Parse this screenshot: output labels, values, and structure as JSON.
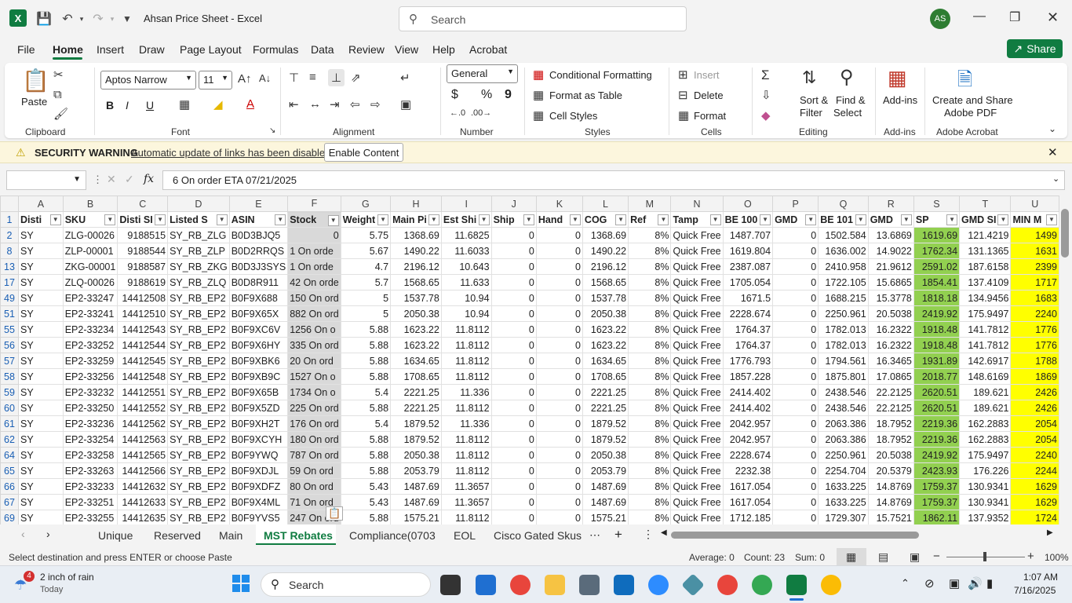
{
  "window": {
    "app_title": "Ahsan Price Sheet  -  Excel",
    "search_placeholder": "Search",
    "avatar_initials": "AS"
  },
  "menu": [
    "File",
    "Home",
    "Insert",
    "Draw",
    "Page Layout",
    "Formulas",
    "Data",
    "Review",
    "View",
    "Help",
    "Acrobat"
  ],
  "share_label": "Share",
  "ribbon": {
    "clipboard": {
      "paste": "Paste",
      "label": "Clipboard"
    },
    "font": {
      "name": "Aptos Narrow",
      "size": "11",
      "label": "Font",
      "bold": "B",
      "italic": "I",
      "underline": "U"
    },
    "alignment": {
      "label": "Alignment"
    },
    "number": {
      "format": "General",
      "label": "Number",
      "currency": "$",
      "percent": "%",
      "comma": "9"
    },
    "styles": {
      "conditional": "Conditional Formatting",
      "table": "Format as Table",
      "cell_styles": "Cell Styles",
      "label": "Styles"
    },
    "cells": {
      "insert": "Insert",
      "delete": "Delete",
      "format": "Format",
      "label": "Cells"
    },
    "editing": {
      "sort": "Sort &",
      "filter": "Filter",
      "find": "Find &",
      "select": "Select",
      "label": "Editing"
    },
    "addins": {
      "btn": "Add-ins",
      "label": "Add-ins"
    },
    "acrobat": {
      "btn1": "Create and Share",
      "btn2": "Adobe PDF",
      "label": "Adobe Acrobat"
    }
  },
  "security": {
    "title": "SECURITY WARNING",
    "message": "Automatic update of links has been disabled",
    "button": "Enable Content"
  },
  "formula": {
    "fx": "fx",
    "value": "6 On order ETA 07/21/2025"
  },
  "columns": [
    "A",
    "B",
    "C",
    "D",
    "E",
    "F",
    "G",
    "H",
    "I",
    "J",
    "K",
    "L",
    "M",
    "N",
    "O",
    "P",
    "Q",
    "R",
    "S",
    "T",
    "U"
  ],
  "headers": [
    "Disti",
    "SKU",
    "Disti SI",
    "Listed S",
    "ASIN",
    "Stock",
    "Weight",
    "Main Pi",
    "Est Shi",
    "Ship",
    "Hand",
    "COG",
    "Ref",
    "Tamp",
    "BE 100",
    "GMD",
    "BE 101",
    "GMD",
    "SP",
    "GMD SI",
    "MIN M"
  ],
  "rows": [
    {
      "n": "2",
      "c": [
        "SY",
        "ZLG-00026",
        "9188515",
        "SY_RB_ZLG",
        "B0D3BJQ5",
        "0",
        "5.75",
        "1368.69",
        "11.6825",
        "0",
        "0",
        "1368.69",
        "8%",
        "Quick Free",
        "1487.707",
        "0",
        "1502.584",
        "13.6869",
        "1619.69",
        "121.4219",
        "1499"
      ]
    },
    {
      "n": "8",
      "c": [
        "SY",
        "ZLP-00001",
        "9188544",
        "SY_RB_ZLP",
        "B0D2RRQS",
        "1 On orde",
        "5.67",
        "1490.22",
        "11.6033",
        "0",
        "0",
        "1490.22",
        "8%",
        "Quick Free",
        "1619.804",
        "0",
        "1636.002",
        "14.9022",
        "1762.34",
        "131.1365",
        "1631"
      ]
    },
    {
      "n": "13",
      "c": [
        "SY",
        "ZKG-00001",
        "9188587",
        "SY_RB_ZKG",
        "B0D3J3SYS",
        "1 On orde",
        "4.7",
        "2196.12",
        "10.643",
        "0",
        "0",
        "2196.12",
        "8%",
        "Quick Free",
        "2387.087",
        "0",
        "2410.958",
        "21.9612",
        "2591.02",
        "187.6158",
        "2399"
      ]
    },
    {
      "n": "17",
      "c": [
        "SY",
        "ZLQ-00026",
        "9188619",
        "SY_RB_ZLQ",
        "B0D8R911",
        "42 On orde",
        "5.7",
        "1568.65",
        "11.633",
        "0",
        "0",
        "1568.65",
        "8%",
        "Quick Free",
        "1705.054",
        "0",
        "1722.105",
        "15.6865",
        "1854.41",
        "137.4109",
        "1717"
      ]
    },
    {
      "n": "49",
      "c": [
        "SY",
        "EP2-33247",
        "14412508",
        "SY_RB_EP2",
        "B0F9X688",
        "150 On ord",
        "5",
        "1537.78",
        "10.94",
        "0",
        "0",
        "1537.78",
        "8%",
        "Quick Free",
        "1671.5",
        "0",
        "1688.215",
        "15.3778",
        "1818.18",
        "134.9456",
        "1683"
      ]
    },
    {
      "n": "51",
      "c": [
        "SY",
        "EP2-33241",
        "14412510",
        "SY_RB_EP2",
        "B0F9X65X",
        "882 On ord",
        "5",
        "2050.38",
        "10.94",
        "0",
        "0",
        "2050.38",
        "8%",
        "Quick Free",
        "2228.674",
        "0",
        "2250.961",
        "20.5038",
        "2419.92",
        "175.9497",
        "2240"
      ]
    },
    {
      "n": "55",
      "c": [
        "SY",
        "EP2-33234",
        "14412543",
        "SY_RB_EP2",
        "B0F9XC6V",
        "1256 On o",
        "5.88",
        "1623.22",
        "11.8112",
        "0",
        "0",
        "1623.22",
        "8%",
        "Quick Free",
        "1764.37",
        "0",
        "1782.013",
        "16.2322",
        "1918.48",
        "141.7812",
        "1776"
      ]
    },
    {
      "n": "56",
      "c": [
        "SY",
        "EP2-33252",
        "14412544",
        "SY_RB_EP2",
        "B0F9X6HY",
        "335 On ord",
        "5.88",
        "1623.22",
        "11.8112",
        "0",
        "0",
        "1623.22",
        "8%",
        "Quick Free",
        "1764.37",
        "0",
        "1782.013",
        "16.2322",
        "1918.48",
        "141.7812",
        "1776"
      ]
    },
    {
      "n": "57",
      "c": [
        "SY",
        "EP2-33259",
        "14412545",
        "SY_RB_EP2",
        "B0F9XBK6",
        "20 On ord",
        "5.88",
        "1634.65",
        "11.8112",
        "0",
        "0",
        "1634.65",
        "8%",
        "Quick Free",
        "1776.793",
        "0",
        "1794.561",
        "16.3465",
        "1931.89",
        "142.6917",
        "1788"
      ]
    },
    {
      "n": "58",
      "c": [
        "SY",
        "EP2-33256",
        "14412548",
        "SY_RB_EP2",
        "B0F9XB9C",
        "1527 On o",
        "5.88",
        "1708.65",
        "11.8112",
        "0",
        "0",
        "1708.65",
        "8%",
        "Quick Free",
        "1857.228",
        "0",
        "1875.801",
        "17.0865",
        "2018.77",
        "148.6169",
        "1869"
      ]
    },
    {
      "n": "59",
      "c": [
        "SY",
        "EP2-33232",
        "14412551",
        "SY_RB_EP2",
        "B0F9X65B",
        "1734 On o",
        "5.4",
        "2221.25",
        "11.336",
        "0",
        "0",
        "2221.25",
        "8%",
        "Quick Free",
        "2414.402",
        "0",
        "2438.546",
        "22.2125",
        "2620.51",
        "189.621",
        "2426"
      ]
    },
    {
      "n": "60",
      "c": [
        "SY",
        "EP2-33250",
        "14412552",
        "SY_RB_EP2",
        "B0F9X5ZD",
        "225 On ord",
        "5.88",
        "2221.25",
        "11.8112",
        "0",
        "0",
        "2221.25",
        "8%",
        "Quick Free",
        "2414.402",
        "0",
        "2438.546",
        "22.2125",
        "2620.51",
        "189.621",
        "2426"
      ]
    },
    {
      "n": "61",
      "c": [
        "SY",
        "EP2-33236",
        "14412562",
        "SY_RB_EP2",
        "B0F9XH2T",
        "176 On ord",
        "5.4",
        "1879.52",
        "11.336",
        "0",
        "0",
        "1879.52",
        "8%",
        "Quick Free",
        "2042.957",
        "0",
        "2063.386",
        "18.7952",
        "2219.36",
        "162.2883",
        "2054"
      ]
    },
    {
      "n": "62",
      "c": [
        "SY",
        "EP2-33254",
        "14412563",
        "SY_RB_EP2",
        "B0F9XCYH",
        "180 On ord",
        "5.88",
        "1879.52",
        "11.8112",
        "0",
        "0",
        "1879.52",
        "8%",
        "Quick Free",
        "2042.957",
        "0",
        "2063.386",
        "18.7952",
        "2219.36",
        "162.2883",
        "2054"
      ]
    },
    {
      "n": "64",
      "c": [
        "SY",
        "EP2-33258",
        "14412565",
        "SY_RB_EP2",
        "B0F9YWQ",
        "787 On ord",
        "5.88",
        "2050.38",
        "11.8112",
        "0",
        "0",
        "2050.38",
        "8%",
        "Quick Free",
        "2228.674",
        "0",
        "2250.961",
        "20.5038",
        "2419.92",
        "175.9497",
        "2240"
      ]
    },
    {
      "n": "65",
      "c": [
        "SY",
        "EP2-33263",
        "14412566",
        "SY_RB_EP2",
        "B0F9XDJL",
        "59 On ord",
        "5.88",
        "2053.79",
        "11.8112",
        "0",
        "0",
        "2053.79",
        "8%",
        "Quick Free",
        "2232.38",
        "0",
        "2254.704",
        "20.5379",
        "2423.93",
        "176.226",
        "2244"
      ]
    },
    {
      "n": "66",
      "c": [
        "SY",
        "EP2-33233",
        "14412632",
        "SY_RB_EP2",
        "B0F9XDFZ",
        "80 On ord",
        "5.43",
        "1487.69",
        "11.3657",
        "0",
        "0",
        "1487.69",
        "8%",
        "Quick Free",
        "1617.054",
        "0",
        "1633.225",
        "14.8769",
        "1759.37",
        "130.9341",
        "1629"
      ]
    },
    {
      "n": "67",
      "c": [
        "SY",
        "EP2-33251",
        "14412633",
        "SY_RB_EP2",
        "B0F9X4ML",
        "71 On ord",
        "5.43",
        "1487.69",
        "11.3657",
        "0",
        "0",
        "1487.69",
        "8%",
        "Quick Free",
        "1617.054",
        "0",
        "1633.225",
        "14.8769",
        "1759.37",
        "130.9341",
        "1629"
      ]
    },
    {
      "n": "69",
      "c": [
        "SY",
        "EP2-33255",
        "14412635",
        "SY_RB_EP2",
        "B0F9YVS5",
        "247 On ord",
        "5.88",
        "1575.21",
        "11.8112",
        "0",
        "0",
        "1575.21",
        "8%",
        "Quick Free",
        "1712.185",
        "0",
        "1729.307",
        "15.7521",
        "1862.11",
        "137.9352",
        "1724"
      ]
    }
  ],
  "sheet_tabs": [
    "Unique",
    "Reserved",
    "Main",
    "MST Rebates",
    "Compliance(0703",
    "EOL",
    "Cisco Gated Skus"
  ],
  "active_tab": "MST Rebates",
  "status": {
    "message": "Select destination and press ENTER or choose Paste",
    "average": "Average: 0",
    "count": "Count: 23",
    "sum": "Sum: 0",
    "zoom": "100%"
  },
  "taskbar": {
    "weather_badge": "4",
    "weather": "2 inch of rain",
    "weather_sub": "Today",
    "search": "Search",
    "time": "1:07 AM",
    "date": "7/16/2025"
  },
  "colors": {
    "excel_green": "#107c41",
    "sp_fill": "#92d050",
    "min_fill": "#ffff00",
    "warning_bg": "#fcf6dd"
  }
}
